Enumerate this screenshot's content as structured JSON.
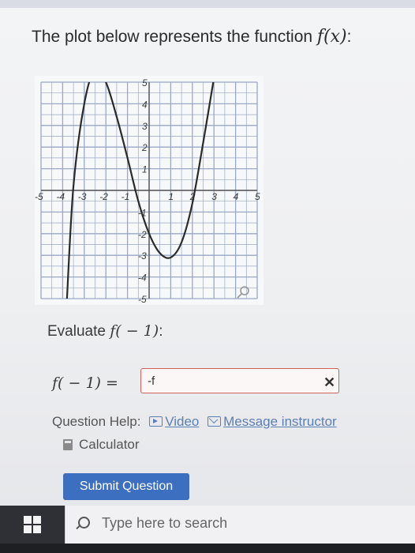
{
  "prompt": {
    "text_before": "The plot below represents the function ",
    "fx": "f(x)",
    "text_after": ":"
  },
  "plot": {
    "x_ticks": [
      "-5",
      "-4",
      "-3",
      "-2",
      "-1",
      "1",
      "2",
      "3",
      "4",
      "5"
    ],
    "y_ticks_pos": [
      "5",
      "4",
      "3",
      "2",
      "1"
    ],
    "y_ticks_neg": [
      "-1",
      "-2",
      "-3",
      "-4",
      "-5"
    ],
    "xlim": [
      -5,
      5
    ],
    "ylim": [
      -5,
      5
    ],
    "curve": [
      [
        -3.8,
        -5
      ],
      [
        -3.5,
        0.2
      ],
      [
        -3,
        4.0
      ],
      [
        -2.5,
        5.6
      ],
      [
        -2,
        5.0
      ],
      [
        -1.5,
        3.4
      ],
      [
        -1,
        1.5
      ],
      [
        -0.5,
        -0.5
      ],
      [
        0,
        -2.0
      ],
      [
        0.5,
        -2.9
      ],
      [
        1,
        -3.1
      ],
      [
        1.5,
        -2.4
      ],
      [
        2,
        -0.6
      ],
      [
        2.5,
        2.2
      ],
      [
        3,
        5.2
      ]
    ],
    "zoom_icon": "magnifier-icon",
    "colors": {
      "grid": "#9aa8c4",
      "curve": "#2a2a2a"
    }
  },
  "evaluate": {
    "label": "Evaluate ",
    "expr": "f( − 1)",
    "suffix": ":"
  },
  "answer": {
    "label": "f( − 1) =",
    "value": "-f",
    "clear": "✕"
  },
  "help": {
    "label": "Question Help:",
    "video": "Video",
    "message": "Message instructor",
    "calculator": "Calculator"
  },
  "submit": {
    "label": "Submit Question"
  },
  "taskbar": {
    "search_placeholder": "Type here to search"
  }
}
